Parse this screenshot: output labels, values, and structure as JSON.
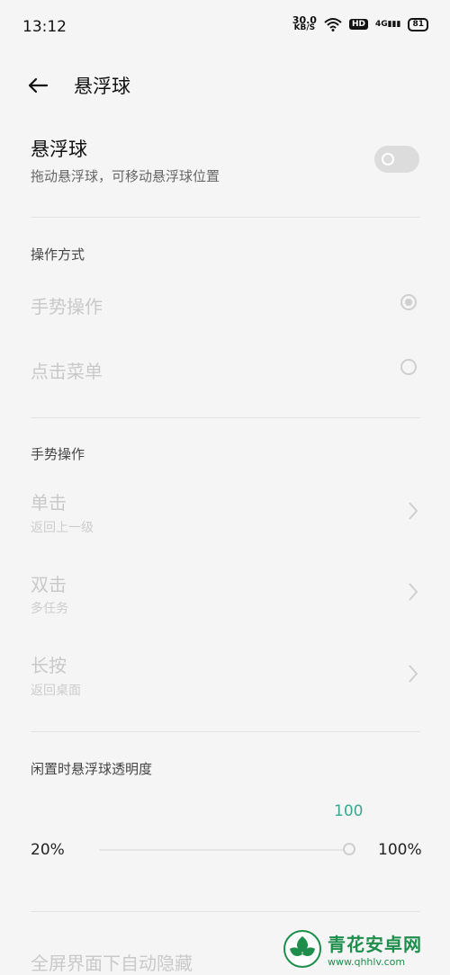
{
  "status_bar": {
    "time": "13:12",
    "speed_value": "30.0",
    "speed_unit": "KB/S",
    "hd_label": "HD",
    "signal_label": "4G",
    "battery": "81"
  },
  "header": {
    "title": "悬浮球"
  },
  "main_toggle": {
    "title": "悬浮球",
    "subtitle": "拖动悬浮球，可移动悬浮球位置"
  },
  "operation_mode": {
    "section_title": "操作方式",
    "options": [
      {
        "label": "手势操作"
      },
      {
        "label": "点击菜单"
      }
    ]
  },
  "gestures": {
    "section_title": "手势操作",
    "items": [
      {
        "title": "单击",
        "subtitle": "返回上一级"
      },
      {
        "title": "双击",
        "subtitle": "多任务"
      },
      {
        "title": "长按",
        "subtitle": "返回桌面"
      }
    ]
  },
  "transparency": {
    "section_title": "闲置时悬浮球透明度",
    "value": "100",
    "min_label": "20%",
    "max_label": "100%"
  },
  "fullscreen": {
    "label": "全屏界面下自动隐藏"
  },
  "watermark": {
    "main": "青花安卓网",
    "url": "www.qhhlv.com"
  },
  "colors": {
    "accent": "#3aa890",
    "disabled_text": "#c9c9c9",
    "background": "#f5f5f5"
  }
}
